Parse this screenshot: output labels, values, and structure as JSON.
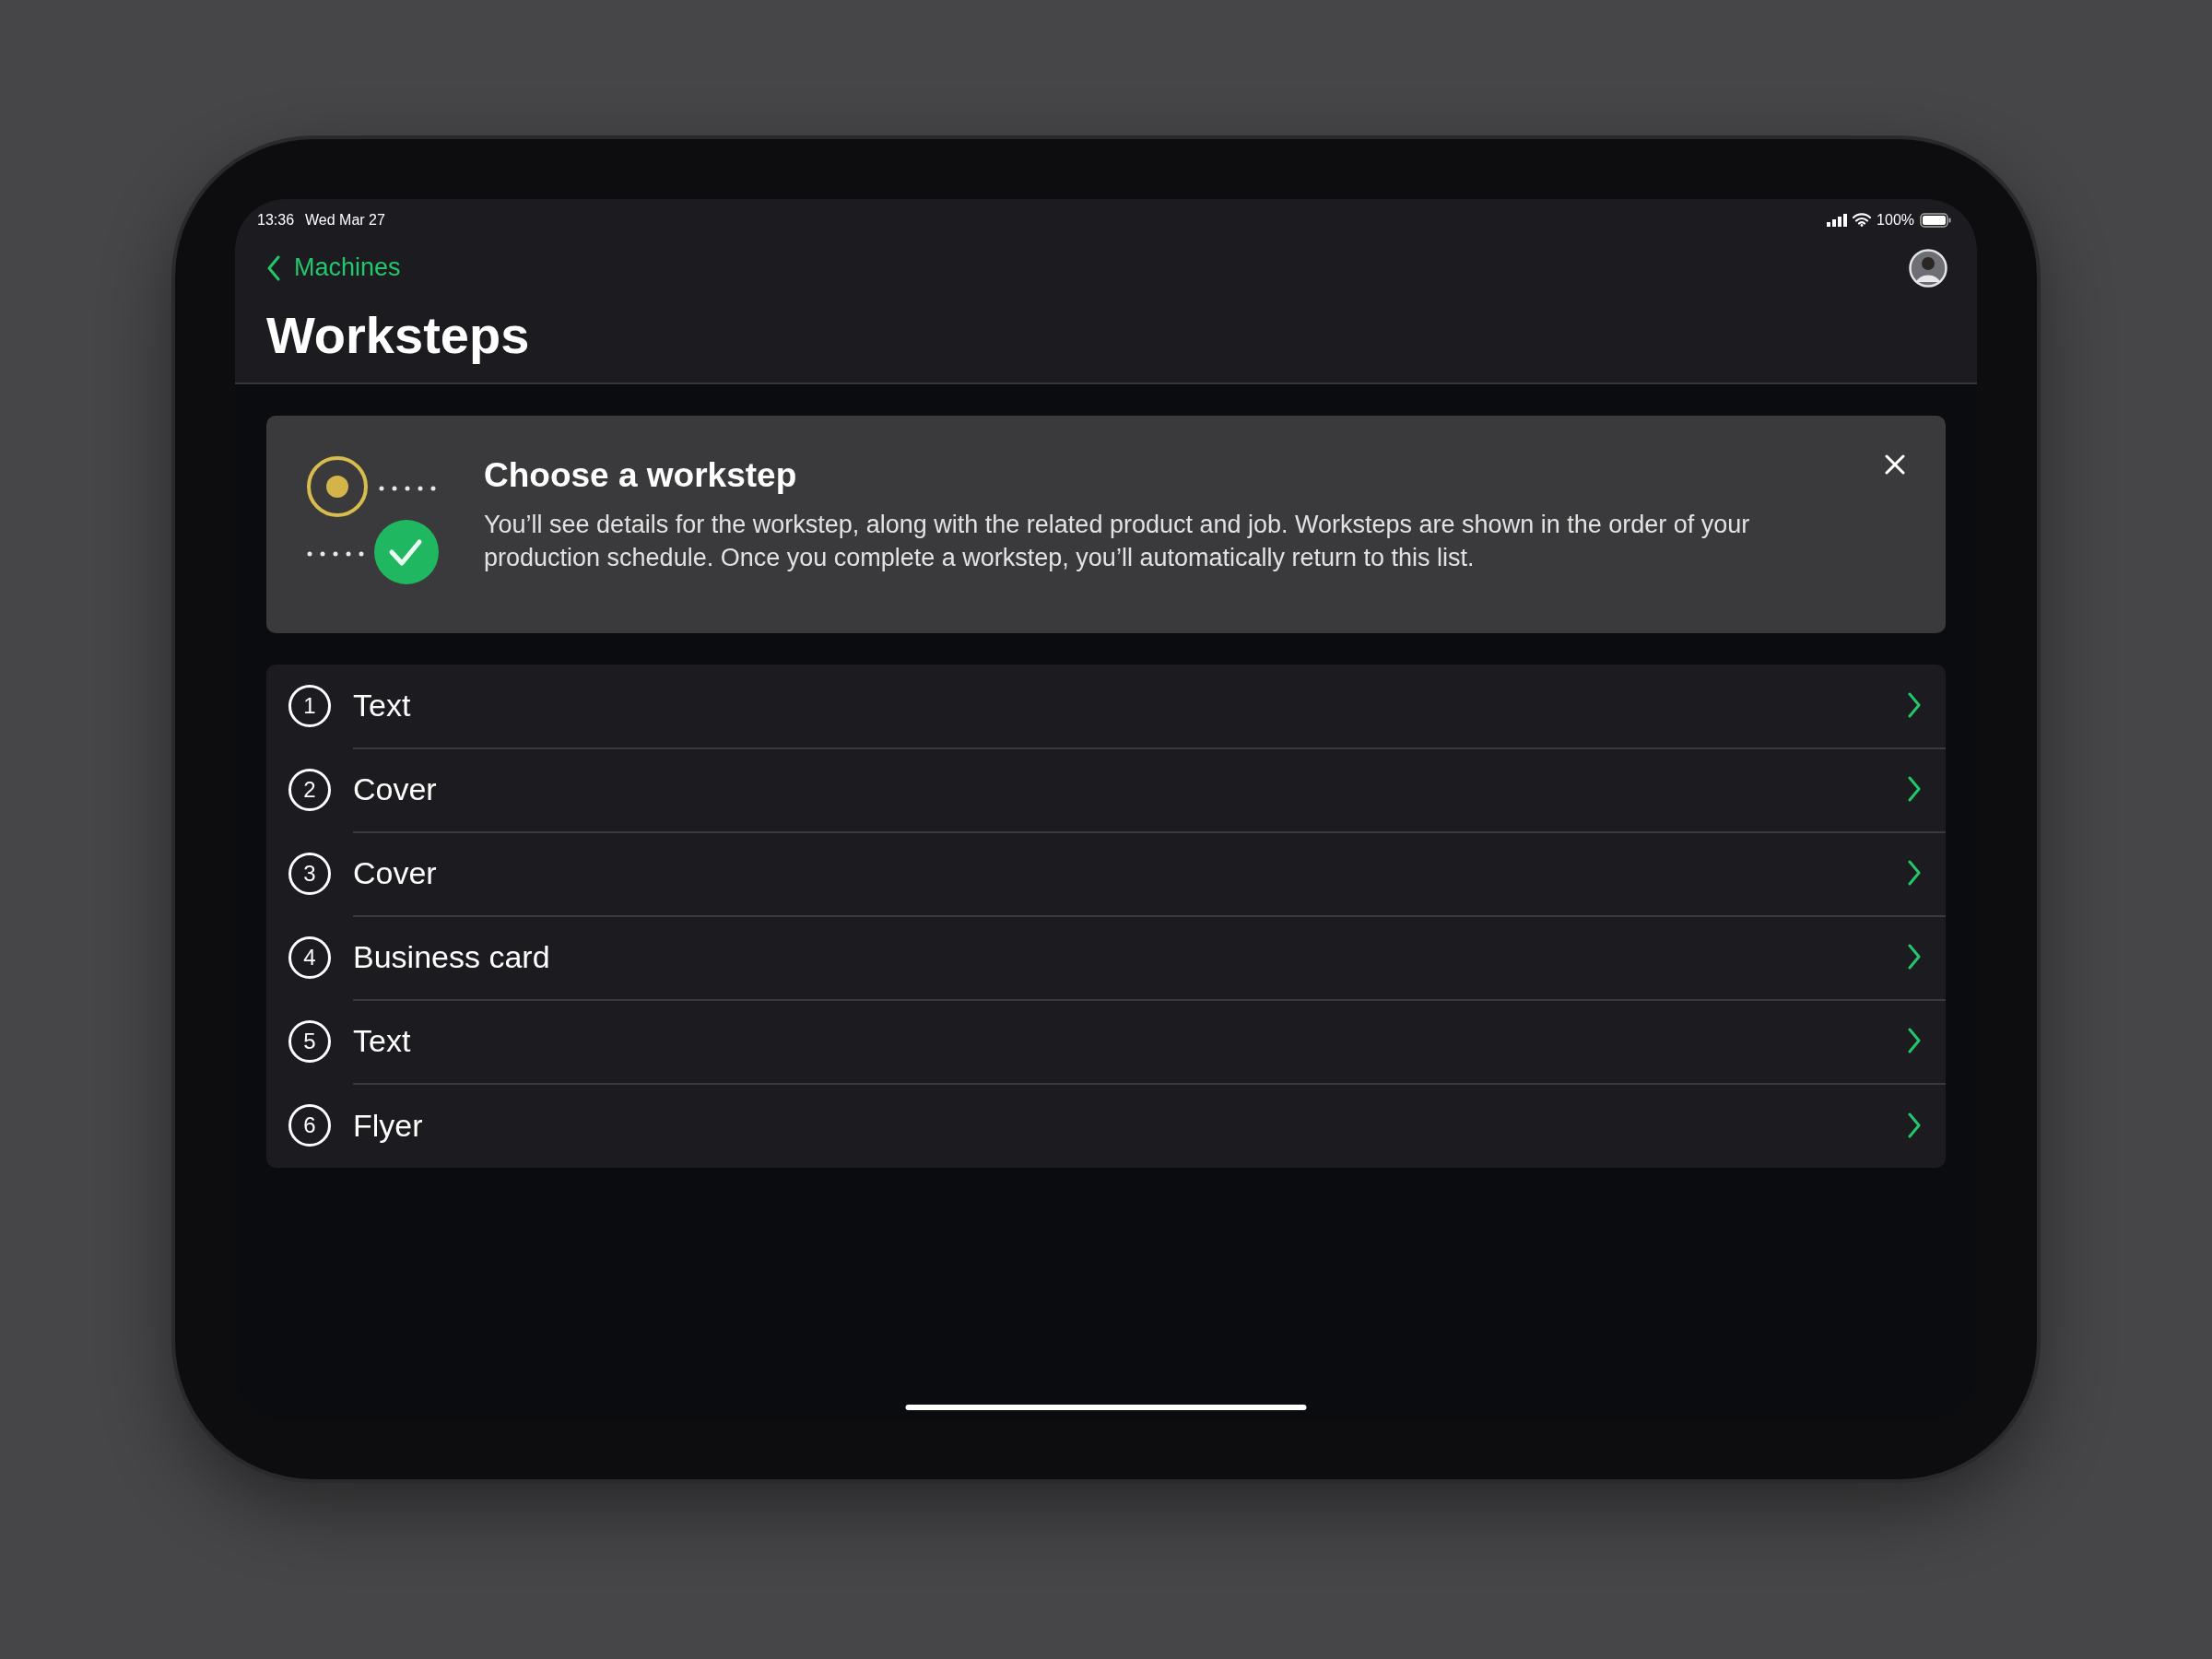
{
  "status_bar": {
    "time": "13:36",
    "date": "Wed Mar 27",
    "battery": "100%"
  },
  "navigation": {
    "back_label": "Machines",
    "title": "Worksteps"
  },
  "banner": {
    "title": "Choose a workstep",
    "body": "You’ll see details for the workstep, along with the related product and job. Worksteps are shown in the order of your production schedule. Once you complete a workstep, you’ll automatically return to this list."
  },
  "worksteps": [
    {
      "number": "1",
      "label": "Text"
    },
    {
      "number": "2",
      "label": "Cover"
    },
    {
      "number": "3",
      "label": "Cover"
    },
    {
      "number": "4",
      "label": "Business card"
    },
    {
      "number": "5",
      "label": "Text"
    },
    {
      "number": "6",
      "label": "Flyer"
    }
  ]
}
